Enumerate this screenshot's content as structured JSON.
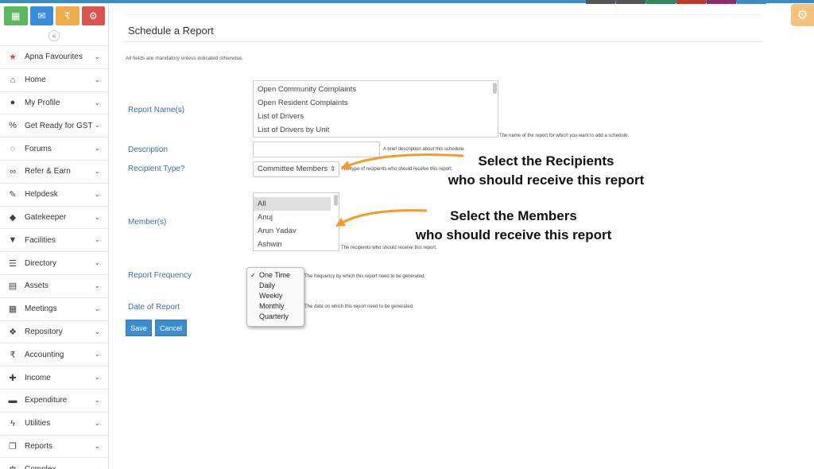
{
  "colors": {
    "accent": "#3c8dcd",
    "arrow": "#f39a2f",
    "label": "#3d6fa3"
  },
  "quick_buttons": [
    {
      "icon": "dashboard-icon",
      "glyph": "▦",
      "color": "#5cb85c"
    },
    {
      "icon": "chat-icon",
      "glyph": "✉",
      "color": "#3a8dde"
    },
    {
      "icon": "rupee-icon",
      "glyph": "₹",
      "color": "#f0ad4e"
    },
    {
      "icon": "settings-icon",
      "glyph": "⚙",
      "color": "#d9534f"
    }
  ],
  "sidebar": {
    "collapse_glyph": "«",
    "items": [
      {
        "label": "Apna Favourites",
        "icon": "star-icon",
        "glyph": "★"
      },
      {
        "label": "Home",
        "icon": "home-icon",
        "glyph": "⌂"
      },
      {
        "label": "My Profile",
        "icon": "user-icon",
        "glyph": "●"
      },
      {
        "label": "Get Ready for GST",
        "icon": "percent-icon",
        "glyph": "%"
      },
      {
        "label": "Forums",
        "icon": "comments-icon",
        "glyph": "◌"
      },
      {
        "label": "Refer & Earn",
        "icon": "handshake-icon",
        "glyph": "∞"
      },
      {
        "label": "Helpdesk",
        "icon": "wrench-icon",
        "glyph": "✎"
      },
      {
        "label": "Gatekeeper",
        "icon": "shield-icon",
        "glyph": "◆"
      },
      {
        "label": "Facilities",
        "icon": "cocktail-icon",
        "glyph": "▼"
      },
      {
        "label": "Directory",
        "icon": "list-icon",
        "glyph": "☰"
      },
      {
        "label": "Assets",
        "icon": "building-icon",
        "glyph": "▤"
      },
      {
        "label": "Meetings",
        "icon": "calendar-icon",
        "glyph": "▦"
      },
      {
        "label": "Repository",
        "icon": "dropbox-icon",
        "glyph": "❖"
      },
      {
        "label": "Accounting",
        "icon": "rupee-icon",
        "glyph": "₹"
      },
      {
        "label": "Income",
        "icon": "plus-icon",
        "glyph": "✚"
      },
      {
        "label": "Expenditure",
        "icon": "minus-icon",
        "glyph": "▬"
      },
      {
        "label": "Utilities",
        "icon": "bolt-icon",
        "glyph": "ϟ"
      },
      {
        "label": "Reports",
        "icon": "copy-icon",
        "glyph": "❐"
      },
      {
        "label": "Complex",
        "icon": "cogs-icon",
        "glyph": "✲"
      }
    ],
    "chevron": "⌄"
  },
  "gear_glyph": "⚙",
  "page": {
    "title": "Schedule a Report",
    "mandatory_note": "All fields are mandatory unless indicated otherwise."
  },
  "form": {
    "report_names": {
      "label": "Report Name(s)",
      "options": [
        "Open Community Complaints",
        "Open Resident Complaints",
        "List of Drivers",
        "List of Drivers by Unit"
      ],
      "help": "The name of the report for which you want to add a schedule."
    },
    "description": {
      "label": "Description",
      "value": "",
      "help": "A brief description about this schedule."
    },
    "recipient_type": {
      "label": "Recipient Type?",
      "value": "Committee Members",
      "arrow_glyph": "⇕",
      "help": "The type of recipients who should receive this report."
    },
    "members": {
      "label": "Member(s)",
      "options": [
        "All",
        "Anuj",
        "Arun Yadav",
        "Ashwin"
      ],
      "selected": "All",
      "help": "The recipients who should receive this report."
    },
    "frequency": {
      "label": "Report Frequency",
      "options": [
        "One Time",
        "Daily",
        "Weekly",
        "Monthly",
        "Quarterly"
      ],
      "selected": "One Time",
      "check_glyph": "✓",
      "help": "The frequency by which this report need to be generated."
    },
    "date": {
      "label": "Date of Report",
      "help": "The date on which this report need to be generated."
    },
    "save_label": "Save",
    "cancel_label": "Cancel"
  },
  "callouts": {
    "recipients_line1": "Select the Recipients",
    "recipients_line2": "who should receive this report",
    "members_line1": "Select the Members",
    "members_line2": "who should receive this report"
  }
}
